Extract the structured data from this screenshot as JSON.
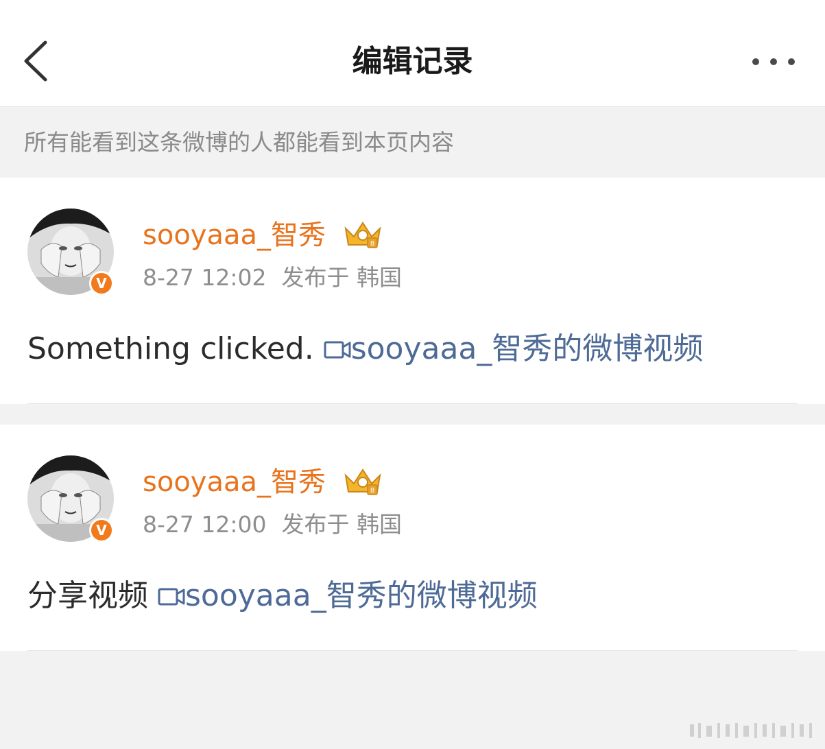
{
  "header": {
    "title": "编辑记录",
    "back_icon": "chevron-left-icon",
    "more_icon": "more-dots-icon"
  },
  "notice": {
    "text": "所有能看到这条微博的人都能看到本页内容"
  },
  "posts": [
    {
      "username": "sooyaaa_智秀",
      "time": "8-27 12:02",
      "location": "发布于 韩国",
      "text": "Something clicked.",
      "video_link": "sooyaaa_智秀的微博视频"
    },
    {
      "username": "sooyaaa_智秀",
      "time": "8-27 12:00",
      "location": "发布于 韩国",
      "text": "分享视频",
      "video_link": "sooyaaa_智秀的微博视频"
    }
  ],
  "badges": {
    "verified": "V"
  },
  "colors": {
    "username": "#e8731c",
    "link": "#4e6a96",
    "verified_badge": "#f07a1c",
    "background": "#f2f2f2"
  }
}
